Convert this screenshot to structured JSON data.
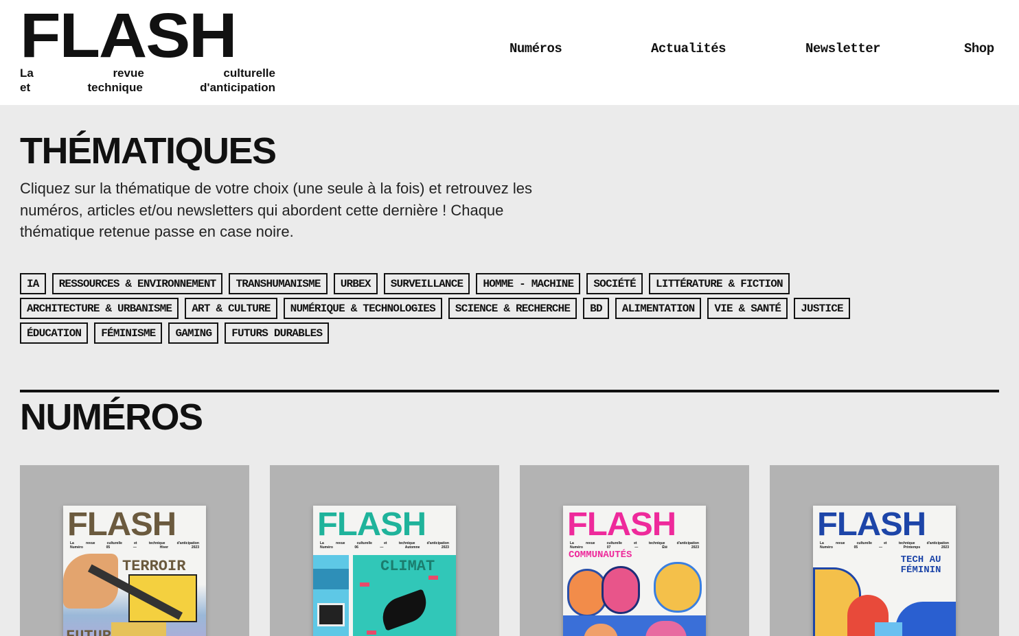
{
  "header": {
    "logo_text": "FLASH",
    "tagline_row1": [
      "La",
      "revue",
      "culturelle"
    ],
    "tagline_row2": [
      "et",
      "technique",
      "d'anticipation"
    ],
    "nav": [
      "Numéros",
      "Actualités",
      "Newsletter",
      "Shop"
    ]
  },
  "themes": {
    "title": "THÉMATIQUES",
    "intro": "Cliquez sur la thématique de votre choix (une seule à la fois) et retrouvez les numéros, articles et/ou newsletters qui abordent cette dernière ! Chaque thématique retenue passe en case noire.",
    "tags_row1": [
      "IA",
      "RESSOURCES & ENVIRONNEMENT",
      "TRANSHUMANISME",
      "URBEX",
      "SURVEILLANCE",
      "HOMME - MACHINE",
      "SOCIÉTÉ",
      "LITTÉRATURE & FICTION"
    ],
    "tags_row2": [
      "ARCHITECTURE & URBANISME",
      "ART & CULTURE",
      "NUMÉRIQUE & TECHNOLOGIES",
      "SCIENCE & RECHERCHE",
      "BD",
      "ALIMENTATION",
      "VIE & SANTÉ",
      "JUSTICE"
    ],
    "tags_row3": [
      "ÉDUCATION",
      "FÉMINISME",
      "GAMING",
      "FUTURS DURABLES"
    ]
  },
  "numeros": {
    "title": "NUMÉROS",
    "issues": [
      {
        "logo": "FLASH",
        "tag1": [
          "La",
          "revue",
          "culturelle",
          "et",
          "technique",
          "d'anticipation"
        ],
        "tag2": [
          "Numéro",
          "05",
          "—",
          "Hiver",
          "2023"
        ],
        "theme": "TERROIR",
        "theme2": "FUTUR",
        "color": "#6b5a3e"
      },
      {
        "logo": "FLASH",
        "tag1": [
          "La",
          "revue",
          "culturelle",
          "et",
          "technique",
          "d'anticipation"
        ],
        "tag2": [
          "Numéro",
          "06",
          "—",
          "Automne",
          "2023"
        ],
        "theme": "CLIMAT",
        "color": "#1fb39b"
      },
      {
        "logo": "FLASH",
        "tag1": [
          "La",
          "revue",
          "culturelle",
          "et",
          "technique",
          "d'anticipation"
        ],
        "tag2": [
          "Numéro",
          "07",
          "—",
          "Été",
          "2023"
        ],
        "theme": "COMMUNAUTÉS",
        "color": "#ee2a9b"
      },
      {
        "logo": "FLASH",
        "tag1": [
          "La",
          "revue",
          "culturelle",
          "et",
          "technique",
          "d'anticipation"
        ],
        "tag2": [
          "Numéro",
          "05",
          "—",
          "Printemps",
          "2023"
        ],
        "theme": "TECH AU FÉMININ",
        "color": "#1d45a8"
      }
    ]
  }
}
